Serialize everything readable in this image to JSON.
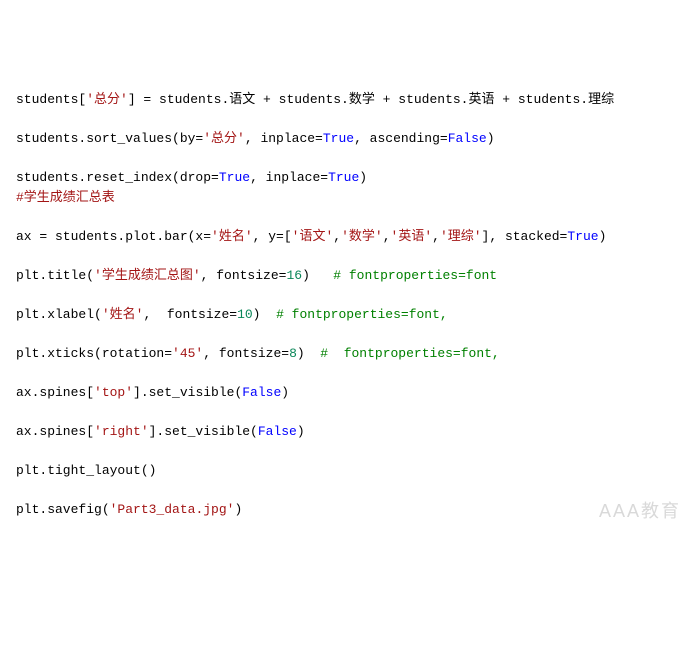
{
  "code": {
    "lines": [
      {
        "tokens": [
          {
            "cls": "tok-default",
            "txt": "students["
          },
          {
            "cls": "tok-string",
            "txt": "'总分'"
          },
          {
            "cls": "tok-default",
            "txt": "] = students.语文 + students.数学 + students.英语 + students.理综"
          }
        ]
      },
      {
        "tokens": []
      },
      {
        "tokens": [
          {
            "cls": "tok-default",
            "txt": "students.sort_values(by="
          },
          {
            "cls": "tok-string",
            "txt": "'总分'"
          },
          {
            "cls": "tok-default",
            "txt": ", inplace="
          },
          {
            "cls": "tok-keyword",
            "txt": "True"
          },
          {
            "cls": "tok-default",
            "txt": ", ascending="
          },
          {
            "cls": "tok-keyword",
            "txt": "False"
          },
          {
            "cls": "tok-default",
            "txt": ")"
          }
        ]
      },
      {
        "tokens": []
      },
      {
        "tokens": [
          {
            "cls": "tok-default",
            "txt": "students.reset_index(drop="
          },
          {
            "cls": "tok-keyword",
            "txt": "True"
          },
          {
            "cls": "tok-default",
            "txt": ", inplace="
          },
          {
            "cls": "tok-keyword",
            "txt": "True"
          },
          {
            "cls": "tok-default",
            "txt": ")"
          }
        ]
      },
      {
        "tokens": [
          {
            "cls": "tok-redcomment",
            "txt": "#学生成绩汇总表"
          }
        ]
      },
      {
        "tokens": []
      },
      {
        "tokens": [
          {
            "cls": "tok-default",
            "txt": "ax = students.plot.bar(x="
          },
          {
            "cls": "tok-string",
            "txt": "'姓名'"
          },
          {
            "cls": "tok-default",
            "txt": ", y=["
          },
          {
            "cls": "tok-string",
            "txt": "'语文'"
          },
          {
            "cls": "tok-default",
            "txt": ","
          },
          {
            "cls": "tok-string",
            "txt": "'数学'"
          },
          {
            "cls": "tok-default",
            "txt": ","
          },
          {
            "cls": "tok-string",
            "txt": "'英语'"
          },
          {
            "cls": "tok-default",
            "txt": ","
          },
          {
            "cls": "tok-string",
            "txt": "'理综'"
          },
          {
            "cls": "tok-default",
            "txt": "], stacked="
          },
          {
            "cls": "tok-keyword",
            "txt": "True"
          },
          {
            "cls": "tok-default",
            "txt": ")"
          }
        ]
      },
      {
        "tokens": []
      },
      {
        "tokens": [
          {
            "cls": "tok-default",
            "txt": "plt.title("
          },
          {
            "cls": "tok-string",
            "txt": "'学生成绩汇总图'"
          },
          {
            "cls": "tok-default",
            "txt": ", fontsize="
          },
          {
            "cls": "tok-number",
            "txt": "16"
          },
          {
            "cls": "tok-default",
            "txt": ")   "
          },
          {
            "cls": "tok-comment",
            "txt": "# fontproperties=font"
          }
        ]
      },
      {
        "tokens": []
      },
      {
        "tokens": [
          {
            "cls": "tok-default",
            "txt": "plt.xlabel("
          },
          {
            "cls": "tok-string",
            "txt": "'姓名'"
          },
          {
            "cls": "tok-default",
            "txt": ",  fontsize="
          },
          {
            "cls": "tok-number",
            "txt": "10"
          },
          {
            "cls": "tok-default",
            "txt": ")  "
          },
          {
            "cls": "tok-comment",
            "txt": "# fontproperties=font,"
          }
        ]
      },
      {
        "tokens": []
      },
      {
        "tokens": [
          {
            "cls": "tok-default",
            "txt": "plt.xticks(rotation="
          },
          {
            "cls": "tok-string",
            "txt": "'45'"
          },
          {
            "cls": "tok-default",
            "txt": ", fontsize="
          },
          {
            "cls": "tok-number",
            "txt": "8"
          },
          {
            "cls": "tok-default",
            "txt": ")  "
          },
          {
            "cls": "tok-comment",
            "txt": "#  fontproperties=font,"
          }
        ]
      },
      {
        "tokens": []
      },
      {
        "tokens": [
          {
            "cls": "tok-default",
            "txt": "ax.spines["
          },
          {
            "cls": "tok-string",
            "txt": "'top'"
          },
          {
            "cls": "tok-default",
            "txt": "].set_visible("
          },
          {
            "cls": "tok-keyword",
            "txt": "False"
          },
          {
            "cls": "tok-default",
            "txt": ")"
          }
        ]
      },
      {
        "tokens": []
      },
      {
        "tokens": [
          {
            "cls": "tok-default",
            "txt": "ax.spines["
          },
          {
            "cls": "tok-string",
            "txt": "'right'"
          },
          {
            "cls": "tok-default",
            "txt": "].set_visible("
          },
          {
            "cls": "tok-keyword",
            "txt": "False"
          },
          {
            "cls": "tok-default",
            "txt": ")"
          }
        ]
      },
      {
        "tokens": []
      },
      {
        "tokens": [
          {
            "cls": "tok-default",
            "txt": "plt.tight_layout()"
          }
        ]
      },
      {
        "tokens": []
      },
      {
        "tokens": [
          {
            "cls": "tok-default",
            "txt": "plt.savefig("
          },
          {
            "cls": "tok-string",
            "txt": "'Part3_data.jpg'"
          },
          {
            "cls": "tok-default",
            "txt": ")"
          }
        ]
      }
    ]
  },
  "watermark": "AAA教育"
}
